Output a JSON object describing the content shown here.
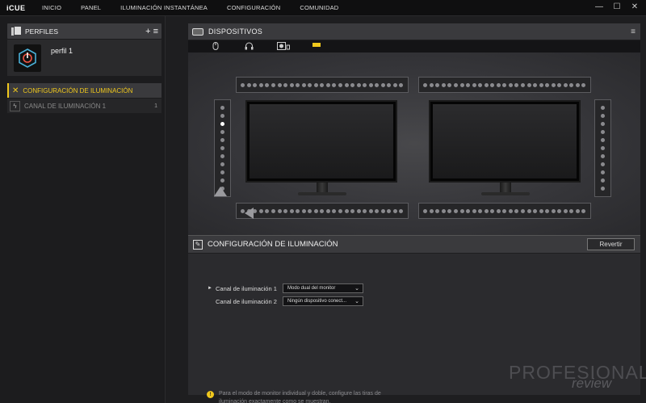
{
  "app": {
    "brand": "iCUE"
  },
  "nav": [
    "INICIO",
    "PANEL",
    "ILUMINACIÓN INSTANTÁNEA",
    "CONFIGURACIÓN",
    "COMUNIDAD"
  ],
  "window": {
    "minimize": "—",
    "maximize": "☐",
    "close": "✕"
  },
  "profiles": {
    "title": "PERFILES",
    "add": "+",
    "menu": "≡",
    "profile_name": "perfil 1"
  },
  "sidebar": {
    "section_active": "CONFIGURACIÓN DE ILUMINACIÓN",
    "channel": "CANAL DE ILUMINACIÓN 1",
    "channel_count": "1"
  },
  "devices": {
    "title": "DISPOSITIVOS",
    "icons": [
      "mouse-icon",
      "headset-icon",
      "controller-icon",
      "commander-icon"
    ]
  },
  "config": {
    "title": "CONFIGURACIÓN DE ILUMINACIÓN",
    "revert_label": "Revertir",
    "channel1_label": "Canal de iluminación 1",
    "channel1_value": "Modo dual del monitor",
    "channel2_label": "Canal de iluminación 2",
    "channel2_value": "Ningún dispositivo conect..."
  },
  "note": "Para el modo de monitor individual y doble, configure las tiras de iluminación exactamente como se muestran.",
  "watermark": {
    "line1": "PROFESIONAL",
    "line2": "review"
  },
  "colors": {
    "accent": "#f0c81d"
  }
}
